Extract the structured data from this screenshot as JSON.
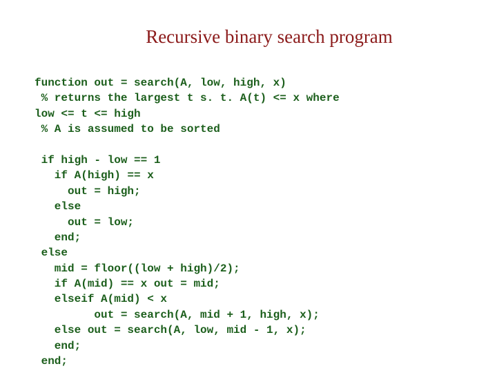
{
  "title": "Recursive binary search program",
  "code": "function out = search(A, low, high, x)\n % returns the largest t s. t. A(t) <= x where\nlow <= t <= high\n % A is assumed to be sorted\n\n if high - low == 1\n   if A(high) == x\n     out = high;\n   else\n     out = low;\n   end;\n else\n   mid = floor((low + high)/2);\n   if A(mid) == x out = mid;\n   elseif A(mid) < x\n         out = search(A, mid + 1, high, x);\n   else out = search(A, low, mid - 1, x);\n   end;\n end;"
}
